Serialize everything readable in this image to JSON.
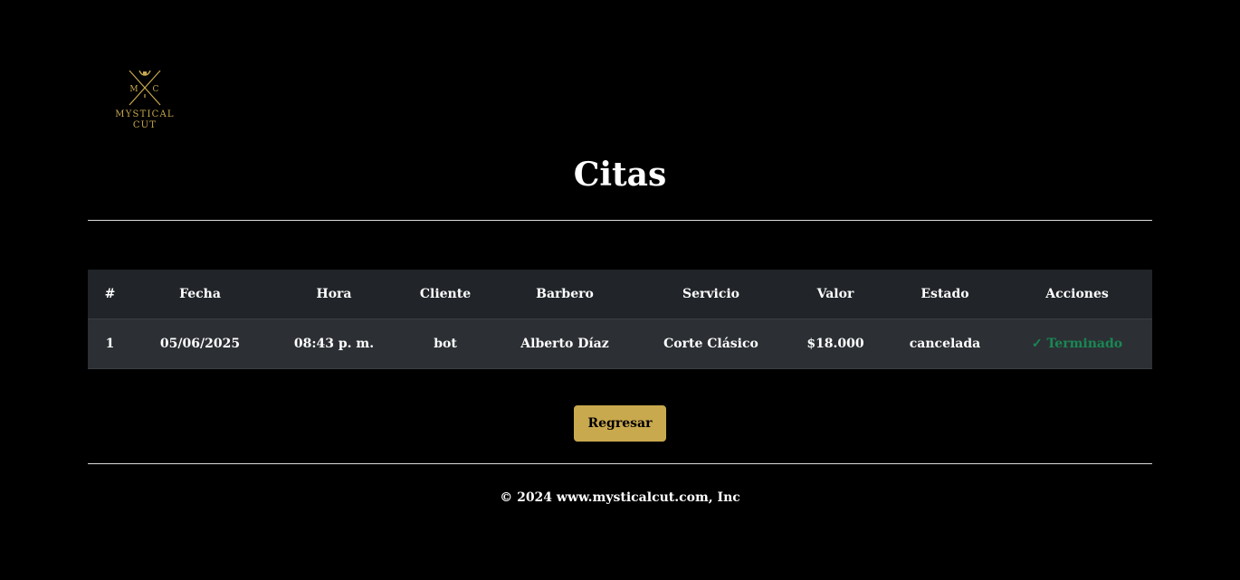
{
  "logo": {
    "letters_left": "M",
    "letters_right": "C",
    "line1": "MYSTICAL",
    "line2": "CUT",
    "color": "#c9a94e"
  },
  "page": {
    "title": "Citas"
  },
  "table": {
    "headers": [
      "#",
      "Fecha",
      "Hora",
      "Cliente",
      "Barbero",
      "Servicio",
      "Valor",
      "Estado",
      "Acciones"
    ],
    "rows": [
      {
        "num": "1",
        "fecha": "05/06/2025",
        "hora": "08:43 p. m.",
        "cliente": "bot",
        "barbero": "Alberto Díaz",
        "servicio": "Corte Clásico",
        "valor": "$18.000",
        "estado": "cancelada",
        "accion": "✓ Terminado"
      }
    ]
  },
  "buttons": {
    "back_label": "Regresar"
  },
  "footer": {
    "text": "© 2024 www.mysticalcut.com, Inc"
  },
  "colors": {
    "accent": "#c9a94e",
    "success": "#198754",
    "header_bg": "#212529",
    "row_bg": "#2c3034"
  }
}
